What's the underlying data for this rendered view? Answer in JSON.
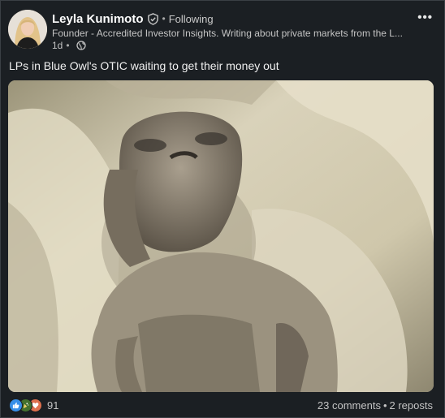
{
  "author": {
    "name": "Leyla Kunimoto",
    "follow_status": "Following",
    "headline": "Founder - Accredited Investor Insights. Writing about private markets from the L...",
    "time": "1d"
  },
  "post": {
    "text": "LPs in Blue Owl's OTIC waiting to get their money out",
    "image_alt": "alien-like mummified figure"
  },
  "engagement": {
    "reaction_count": "91",
    "comments": "23 comments",
    "reposts": "2 reposts"
  },
  "icons": {
    "verified": "verified-shield-icon",
    "globe": "globe-icon",
    "more": "more-options-icon",
    "reactions": [
      "like-icon",
      "celebrate-icon",
      "love-icon"
    ]
  },
  "colors": {
    "background": "#1b1f23",
    "like": "#378fe9",
    "celebrate": "#44712e",
    "love": "#df704d"
  }
}
